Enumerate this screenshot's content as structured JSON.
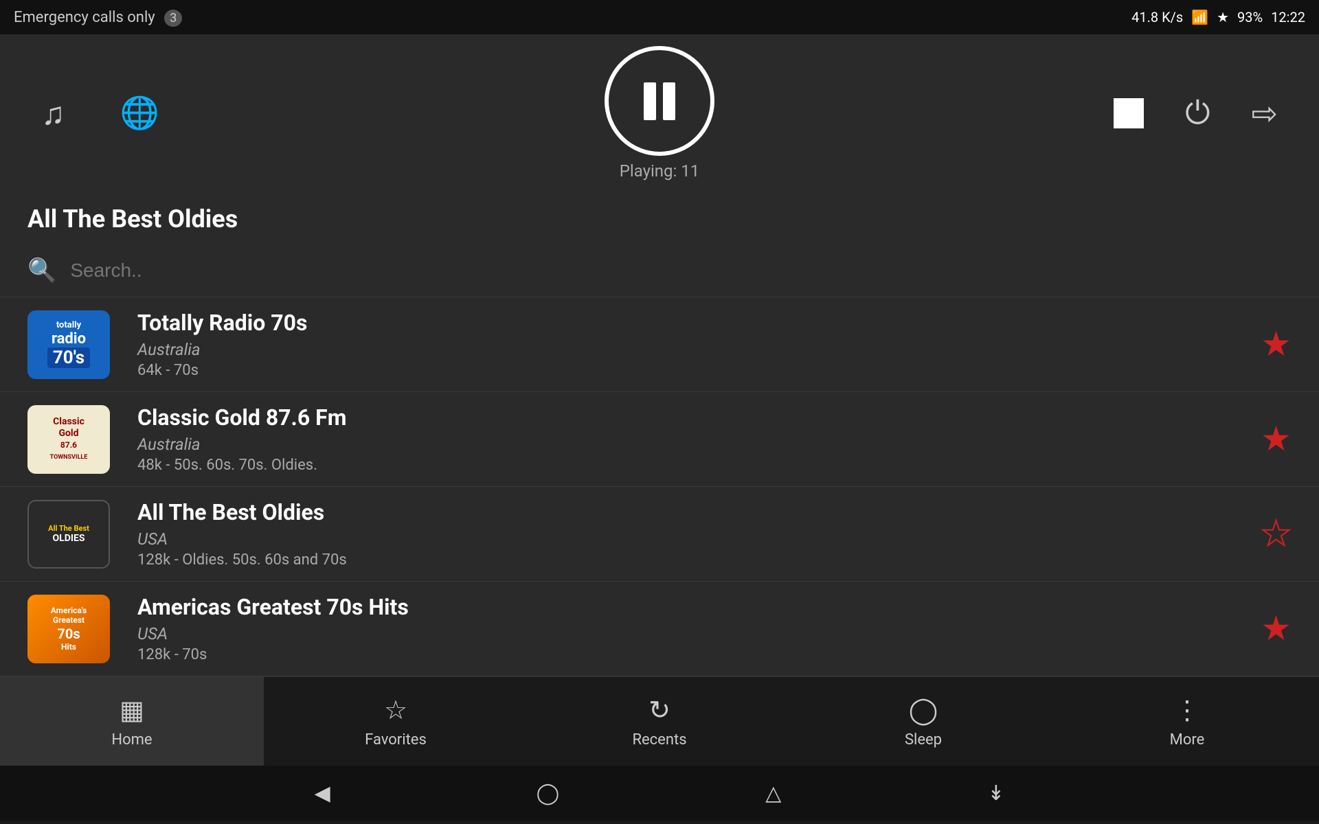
{
  "statusBar": {
    "leftText": "Emergency calls only",
    "badge": "3",
    "rightText": "41.8 K/s",
    "time": "12:22",
    "battery": "93%"
  },
  "player": {
    "playingLabel": "Playing: 11",
    "stationTitle": "All The Best Oldies"
  },
  "search": {
    "placeholder": "Search.."
  },
  "stations": [
    {
      "name": "Totally Radio 70s",
      "country": "Australia",
      "meta": "64k - 70s",
      "favorited": true,
      "logoType": "totally"
    },
    {
      "name": "Classic Gold 87.6 Fm",
      "country": "Australia",
      "meta": "48k - 50s. 60s. 70s. Oldies.",
      "favorited": true,
      "logoType": "classic"
    },
    {
      "name": "All The Best Oldies",
      "country": "USA",
      "meta": "128k - Oldies. 50s. 60s and 70s",
      "favorited": false,
      "logoType": "oldies"
    },
    {
      "name": "Americas Greatest 70s Hits",
      "country": "USA",
      "meta": "128k - 70s",
      "favorited": true,
      "logoType": "americas"
    }
  ],
  "bottomNav": {
    "items": [
      {
        "label": "Home",
        "icon": "home",
        "active": true
      },
      {
        "label": "Favorites",
        "icon": "star",
        "active": false
      },
      {
        "label": "Recents",
        "icon": "history",
        "active": false
      },
      {
        "label": "Sleep",
        "icon": "sleep",
        "active": false
      },
      {
        "label": "More",
        "icon": "more",
        "active": false
      }
    ]
  },
  "logos": {
    "totally": {
      "line1": "totally",
      "line2": "radio",
      "line3": "70's"
    },
    "classic": {
      "line1": "Classic",
      "line2": "Gold",
      "line3": "87.6",
      "line4": "TOWNSVILLE"
    },
    "oldies": {
      "line1": "All The Best",
      "line2": "OLDIES"
    },
    "americas": {
      "line1": "America's",
      "line2": "Greatest",
      "line3": "70s",
      "line4": "Hits"
    }
  }
}
